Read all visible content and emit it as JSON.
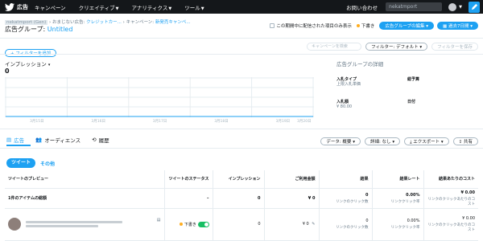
{
  "topbar": {
    "brand": "広告",
    "menus": [
      "キャンペーン",
      "クリエイティブ",
      "アナリティクス",
      "ツール"
    ],
    "help": "お問い合わせ",
    "account": "nekatmport"
  },
  "breadcrumb": {
    "account": "nekatmport (Gen)",
    "campaign_type_prefix": "おまじない広告: ",
    "campaign_type": "クレジットカー...",
    "campaign_prefix": "キャンペーン: ",
    "campaign": "新発売キャンペ..."
  },
  "title": {
    "label": "広告グループ: ",
    "value": "Untitled"
  },
  "header_right": {
    "checkbox_label": "この期間中に配信された項目のみ表示",
    "draft": "下書き",
    "edit_button": "広告グループの編集",
    "period_button": "過去7日間"
  },
  "toolbar": {
    "add_filter": "+ フィルターを追加",
    "search_placeholder": "キャンペーンを検索",
    "filter_default": "フィルター: デフォルト",
    "save_filter": "フィルターを保存"
  },
  "metric": {
    "label": "インプレッション",
    "value": "0"
  },
  "chart_data": {
    "type": "line",
    "x": [
      "3月15日",
      "3月16日",
      "3月17日",
      "3月18日",
      "3月19日",
      "3月20日"
    ],
    "series": [
      {
        "values": [
          0,
          0,
          0,
          0,
          0,
          0
        ]
      }
    ]
  },
  "details": {
    "title": "広告グループの詳細",
    "objective_label": "入札タイプ",
    "objective_value": "上限入札単価",
    "total_budget_label": "総予算",
    "total_budget_value": "",
    "bid_label": "入札額",
    "bid_value": "¥ 80.00",
    "date_label": "日付",
    "date_value": ""
  },
  "tabs": {
    "ads": "広告",
    "audience": "オーディエンス",
    "history": "履歴"
  },
  "tabtools": {
    "data": "データ: 概要",
    "breakdown": "詳細: なし",
    "export": "エクスポート",
    "share": "共有"
  },
  "subtabs": {
    "tweets": "ツイート",
    "other": "その他"
  },
  "table": {
    "headers": {
      "preview": "ツイートのプレビュー",
      "status": "ツイートのステータス",
      "impressions": "インプレッション",
      "spend": "ご利用金額",
      "results": "結果",
      "result_rate": "結果レート",
      "cost_per_result": "結果あたりのコスト"
    },
    "total": {
      "label": "1件のアイテムの総額",
      "status": "–",
      "impressions": "0",
      "spend": "¥ 0",
      "results": "0",
      "results_sub": "リンクのクリック数",
      "result_rate": "0.00%",
      "result_rate_sub": "リンククリック率",
      "cost": "¥ 0.00",
      "cost_sub": "リンクのクリックあたりのコスト"
    },
    "row": {
      "status": "下書き",
      "impressions": "0",
      "spend": "¥ 0",
      "results": "0",
      "results_sub": "リンクのクリック数",
      "result_rate": "0.00%",
      "result_rate_sub": "リンククリック率",
      "cost": "¥ 0.00",
      "cost_sub": "リンクのクリックあたりのコスト"
    }
  },
  "colors": {
    "accent": "#1da1f2",
    "topbar": "#14171a",
    "draft": "#ffad1f",
    "toggle_on": "#17bf63"
  }
}
